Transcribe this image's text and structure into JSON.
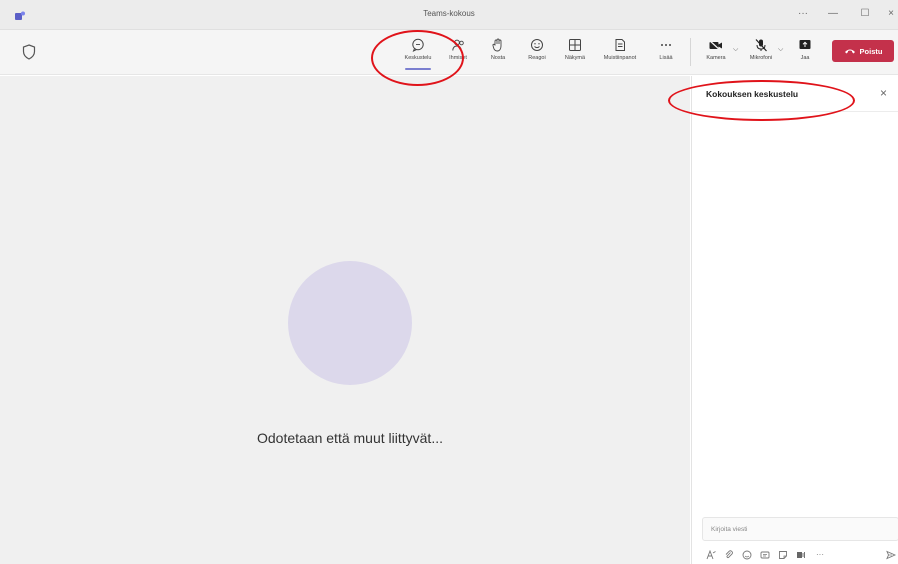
{
  "window": {
    "title": "Teams-kokous",
    "controls": {
      "more": "···",
      "minimize": "—",
      "maximize": "☐",
      "close": "×"
    }
  },
  "toolbar": {
    "items": [
      {
        "label": "Keskustelu",
        "icon": "chat-bubble-icon",
        "active": true
      },
      {
        "label": "Ihmiset",
        "icon": "people-icon"
      },
      {
        "label": "Nosta",
        "icon": "raise-hand-icon"
      },
      {
        "label": "Reagoi",
        "icon": "emoji-icon"
      },
      {
        "label": "Näkymä",
        "icon": "grid-icon"
      },
      {
        "label": "Muistiinpanot",
        "icon": "notes-icon"
      },
      {
        "label": "Lisää",
        "icon": "more-icon"
      }
    ],
    "camera_label": "Kamera",
    "mic_label": "Mikrofoni",
    "share_label": "Jaa",
    "leave_label": "Poistu",
    "accent_color": "#7b7fd0",
    "leave_color": "#c4314b"
  },
  "stage": {
    "waiting_text": "Odotetaan että muut liittyvät..."
  },
  "chat_panel": {
    "title": "Kokouksen keskustelu",
    "close": "×",
    "compose_placeholder": "Kirjoita viesti",
    "compose_tools": [
      "format-icon",
      "attach-icon",
      "emoji-icon",
      "gif-icon",
      "sticker-icon",
      "loop-icon",
      "more-icon",
      "send-icon"
    ],
    "more": "···"
  },
  "annotations": {
    "color": "#e0131a"
  }
}
